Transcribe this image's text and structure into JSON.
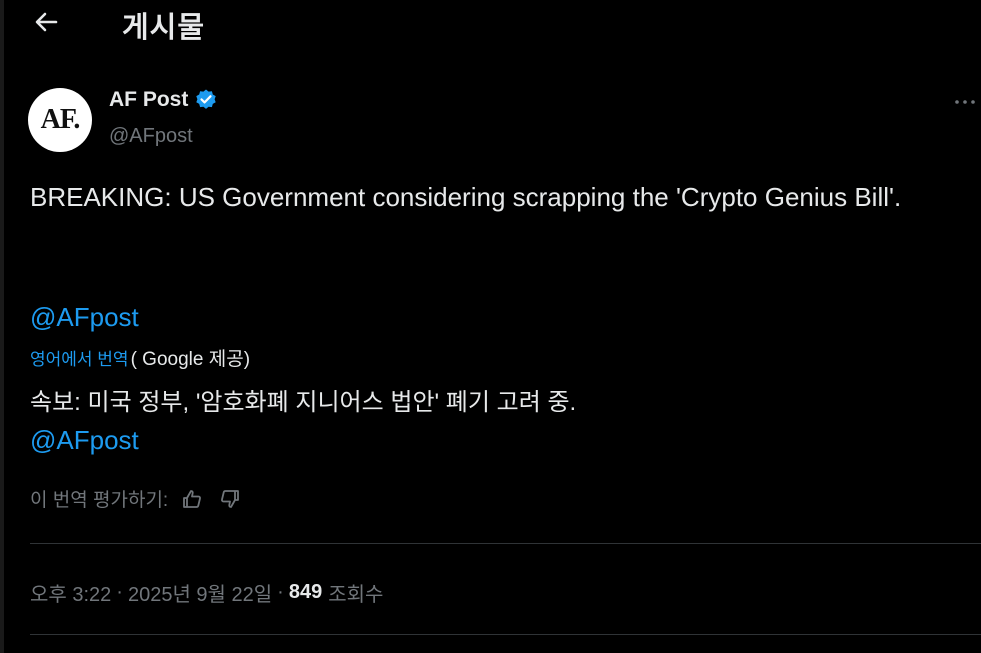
{
  "header": {
    "title": "게시물",
    "back_icon": "arrow-left-icon"
  },
  "author": {
    "avatar_text": "AF.",
    "display_name": "AF Post",
    "handle": "@AFpost",
    "verified": true,
    "verified_color": "#1d9bf0"
  },
  "tweet": {
    "text": "BREAKING: US Government considering scrapping the 'Crypto Genius Bill'.",
    "mention": "@AFpost"
  },
  "translation": {
    "link_label": "영어에서 번역",
    "provider_label": "( Google 제공)",
    "text": "속보: 미국 정부, '암호화폐 지니어스 법안' 폐기 고려 중.",
    "mention": "@AFpost",
    "rate_label": "이 번역 평가하기:"
  },
  "meta": {
    "time": "오후 3:22",
    "separator": "·",
    "date": "2025년 9월 22일",
    "views_count": "849",
    "views_label": "조회수"
  },
  "colors": {
    "accent": "#1d9bf0",
    "background": "#000000",
    "text": "#e7e9ea",
    "muted": "#71767b"
  }
}
